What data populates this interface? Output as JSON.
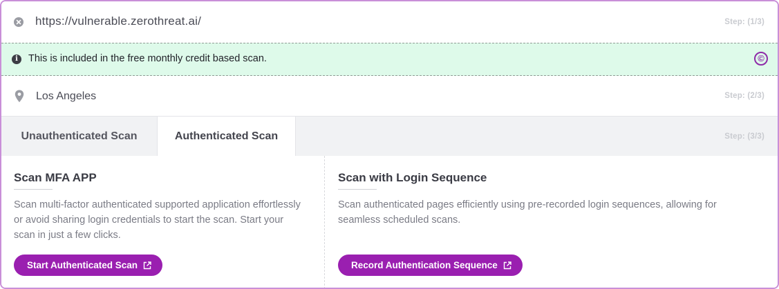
{
  "url_row": {
    "url": "https://vulnerable.zerothreat.ai/",
    "step": "Step: (1/3)",
    "clear_icon": "close-circle-icon"
  },
  "info_row": {
    "text": "This is included in the free monthly credit based scan.",
    "info_icon": "info-icon",
    "credit_symbol": "©"
  },
  "location_row": {
    "location": "Los Angeles",
    "step": "Step: (2/3)",
    "icon": "map-pin-icon"
  },
  "tabs": {
    "items": [
      {
        "label": "Unauthenticated Scan",
        "active": false
      },
      {
        "label": "Authenticated Scan",
        "active": true
      }
    ],
    "step": "Step: (3/3)"
  },
  "panels": [
    {
      "title": "Scan MFA APP",
      "description": "Scan multi-factor authenticated supported application effortlessly or avoid sharing login credentials to start the scan. Start your scan in just a few clicks.",
      "button": "Start Authenticated Scan"
    },
    {
      "title": "Scan with Login Sequence",
      "description": "Scan authenticated pages efficiently using pre-recorded login sequences, allowing for seamless scheduled scans.",
      "button": "Record Authentication Sequence"
    }
  ],
  "colors": {
    "accent": "#9a1fb0",
    "info_bg": "#defaea",
    "border": "#c98fd8"
  }
}
